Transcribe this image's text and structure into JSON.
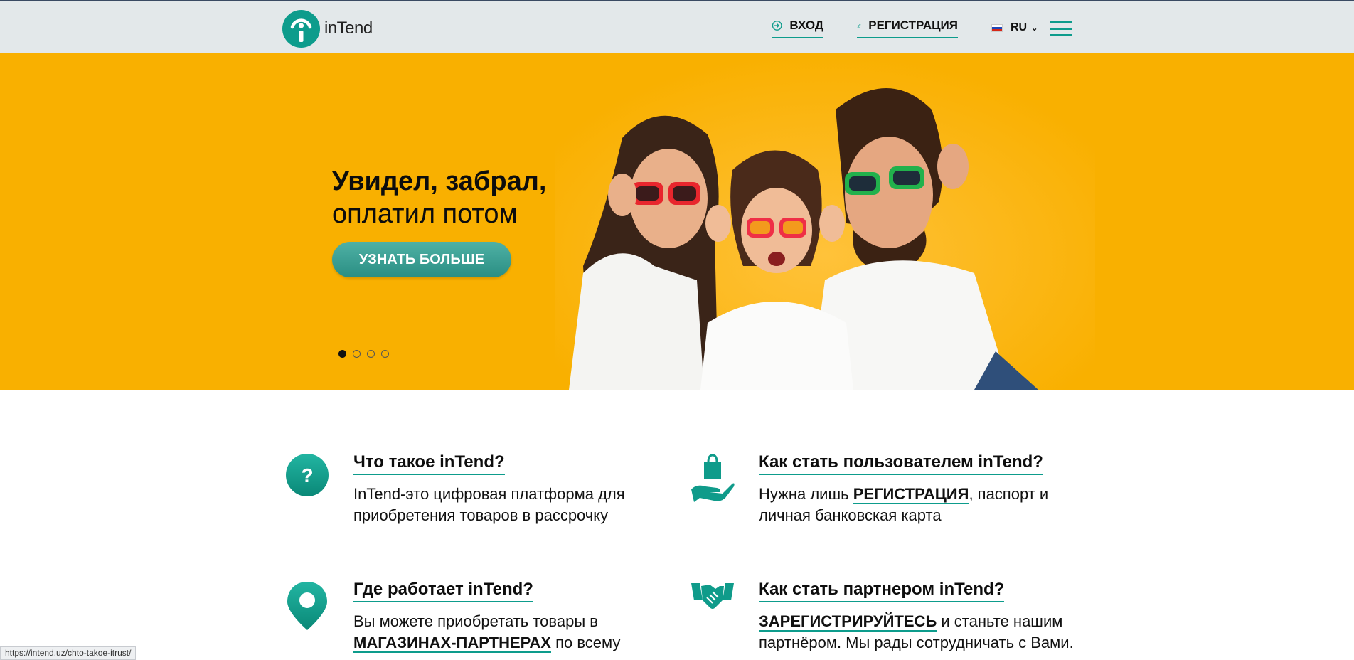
{
  "header": {
    "logo_text": "inTend",
    "login_label": "ВХОД",
    "register_label": "РЕГИСТРАЦИЯ",
    "language": "RU",
    "brand_color": "#0d9c8c"
  },
  "hero": {
    "title_line1": "Увидел, забрал,",
    "title_line2": "оплатил потом",
    "cta_label": "УЗНАТЬ БОЛЬШЕ",
    "background_color": "#f9b000",
    "slides_count": 4,
    "active_slide": 1
  },
  "features": [
    {
      "icon": "question-icon",
      "title": "Что такое inTend?",
      "text_before": "InTend-это цифровая платформа для приобретения товаров в рассрочку",
      "highlight": "",
      "text_after": ""
    },
    {
      "icon": "hand-shopping-bag-icon",
      "title": "Как стать пользователем inTend?",
      "text_before": "Нужна лишь ",
      "highlight": "РЕГИСТРАЦИЯ",
      "text_after": ", паспорт и личная банковская карта"
    },
    {
      "icon": "location-pin-icon",
      "title": "Где работает inTend?",
      "text_before": "Вы можете приобретать товары в ",
      "highlight": "МАГАЗИНАХ-ПАРТНЕРАХ",
      "text_after": " по всему"
    },
    {
      "icon": "handshake-icon",
      "title": "Как стать партнером inTend?",
      "text_before": "",
      "highlight": "ЗАРЕГИСТРИРУЙТЕСЬ",
      "text_after": " и станьте нашим партнёром. Мы рады сотрудничать с Вами."
    }
  ],
  "status_bar": {
    "url": "https://intend.uz/chto-takoe-itrust/"
  }
}
